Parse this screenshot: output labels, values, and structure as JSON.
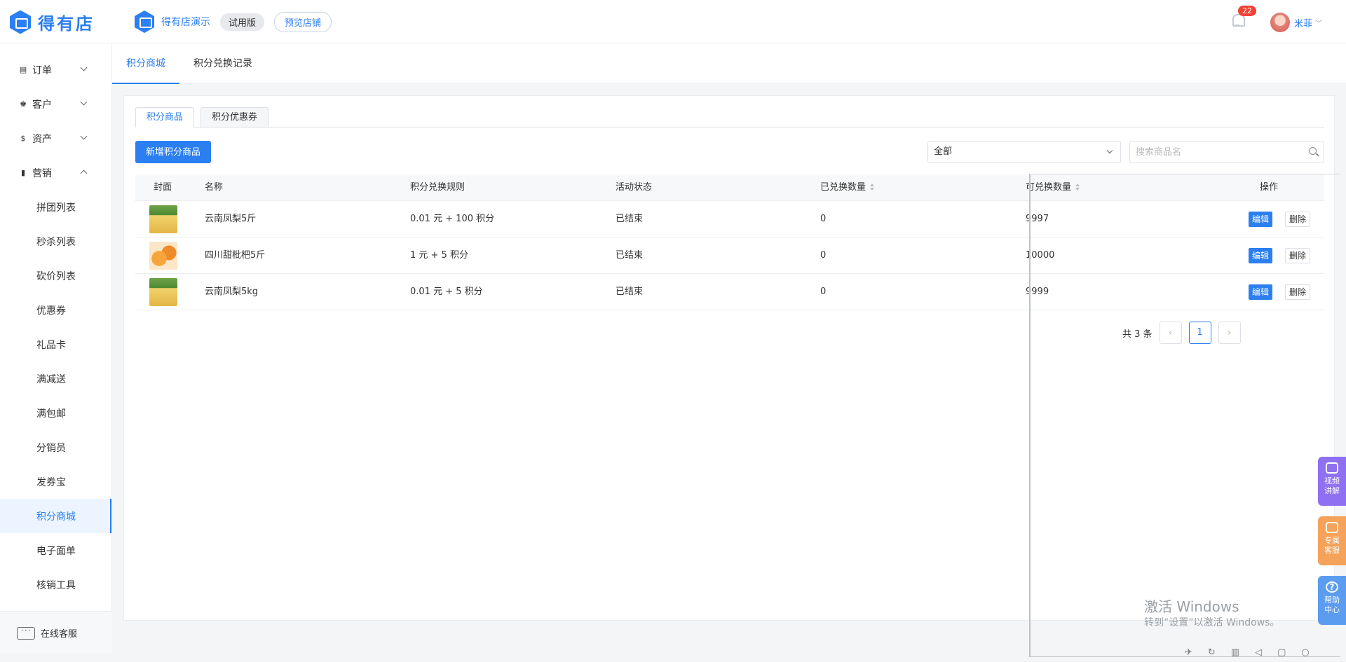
{
  "brand": {
    "name": "得有店"
  },
  "shop": {
    "name": "得有店演示",
    "trial_label": "试用版",
    "preview_label": "预览店铺"
  },
  "header": {
    "notification_count": "22",
    "username": "米菲",
    "caret": "﹀"
  },
  "sidebar": {
    "groups": [
      {
        "label": "订单",
        "icon": "order-icon",
        "glyph": "▤"
      },
      {
        "label": "客户",
        "icon": "customer-icon",
        "glyph": "♚"
      },
      {
        "label": "资产",
        "icon": "dollar-icon",
        "glyph": "$"
      },
      {
        "label": "营销",
        "icon": "chart-icon",
        "glyph": "▮"
      }
    ],
    "marketing_items": [
      "拼团列表",
      "秒杀列表",
      "砍价列表",
      "优惠券",
      "礼品卡",
      "满减送",
      "满包邮",
      "分销员",
      "发券宝",
      "积分商城",
      "电子面单",
      "核销工具"
    ],
    "active_item": "积分商城",
    "footer_label": "在线客服"
  },
  "main_tabs": [
    "积分商城",
    "积分兑换记录"
  ],
  "sub_tabs": [
    "积分商品",
    "积分优惠券"
  ],
  "toolbar": {
    "add_label": "新增积分商品",
    "filter_value": "全部",
    "search_placeholder": "搜索商品名"
  },
  "table": {
    "columns": [
      "封面",
      "名称",
      "积分兑换规则",
      "活动状态",
      "已兑换数量",
      "可兑换数量",
      "操作"
    ],
    "rows": [
      {
        "cover": "pineapple",
        "name": "云南凤梨5斤",
        "rule": "0.01 元 + 100 积分",
        "status": "已结束",
        "redeemed": "0",
        "available": "9997",
        "edit": "编辑",
        "delete": "删除"
      },
      {
        "cover": "loquat",
        "name": "四川甜枇杷5斤",
        "rule": "1 元 + 5 积分",
        "status": "已结束",
        "redeemed": "0",
        "available": "10000",
        "edit": "编辑",
        "delete": "删除"
      },
      {
        "cover": "pineapple",
        "name": "云南凤梨5kg",
        "rule": "0.01 元 + 5 积分",
        "status": "已结束",
        "redeemed": "0",
        "available": "9999",
        "edit": "编辑",
        "delete": "删除"
      }
    ]
  },
  "pagination": {
    "total_label": "共 3 条",
    "current_page": "1",
    "prev": "‹",
    "next": "›"
  },
  "float_buttons": [
    {
      "label_1": "视频",
      "label_2": "讲解",
      "color": "#8f6ff2"
    },
    {
      "label_1": "专属",
      "label_2": "客服",
      "color": "#f5a25a"
    },
    {
      "label_1": "帮助",
      "label_2": "中心",
      "color": "#5b9cf0",
      "glyph": "?"
    }
  ],
  "watermark": {
    "line1": "激活 Windows",
    "line2": "转到“设置”以激活 Windows。"
  },
  "colors": {
    "accent": "#2b7ff0",
    "badge": "#f04134"
  }
}
